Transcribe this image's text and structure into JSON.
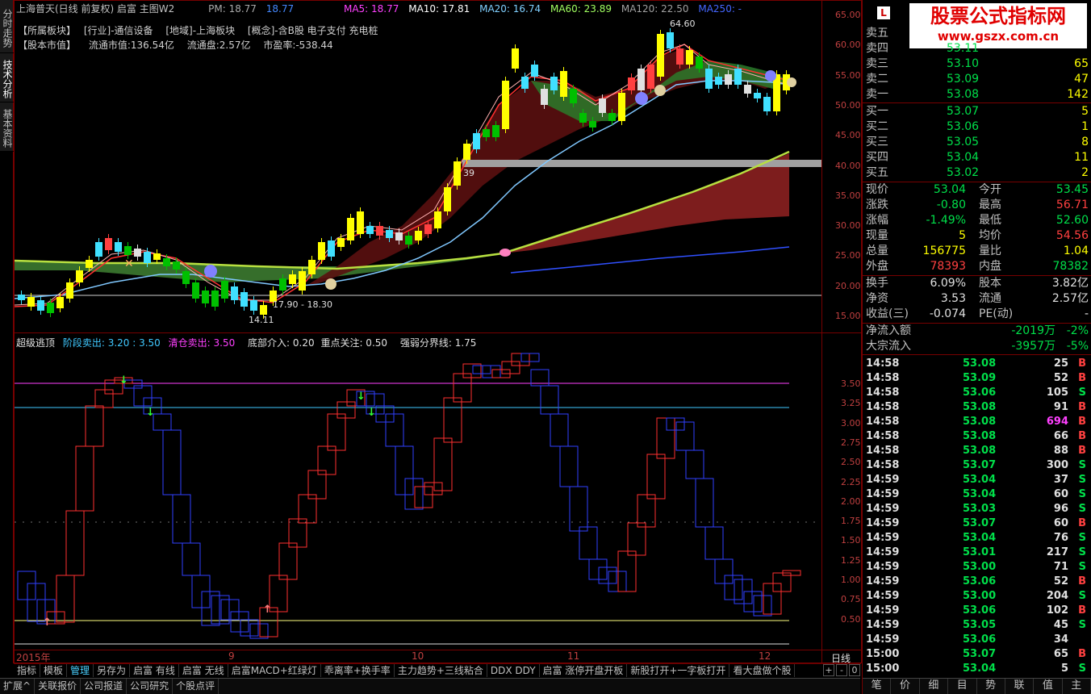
{
  "title": {
    "stock": "上海普天(日线 前复权) 启富 主图W2",
    "pm": "PM: 18.77",
    "pm2": "18.77",
    "ma5": "MA5: 18.77",
    "ma10": "MA10: 17.81",
    "ma20": "MA20: 16.74",
    "ma60": "MA60: 23.89",
    "ma120": "MA120: 22.50",
    "ma250": "MA250: -"
  },
  "info": {
    "line1": [
      "【所属板块】",
      "[行业]-通信设备",
      "[地域]-上海板块",
      "[概念]-含B股 电子支付 充电桩"
    ],
    "line2_label": "【股本市值】",
    "float_value": "流通市值:136.54亿",
    "float_shares": "流通盘:2.57亿",
    "pe": "市盈率:-538.44"
  },
  "sidetabs": [
    "分时走势",
    "技术分析",
    "基本资料"
  ],
  "price_axis": [
    "65.00",
    "60.00",
    "55.00",
    "50.00",
    "45.00",
    "40.00",
    "35.00",
    "30.00",
    "25.00",
    "20.00",
    "15.00"
  ],
  "chart_annotations": {
    "high": "64.60",
    "low": "14.11",
    "range": "17.90 - 18.30",
    "mid": "39"
  },
  "indicator": {
    "name": "超级逃顶",
    "stage_sell": "阶段卖出: 3.20 : 3.50",
    "clear_sell": "清仓卖出: 3.50",
    "bottom": "底部介入: 0.20",
    "focus": "重点关注: 0.50",
    "strong": "强弱分界线: 1.75"
  },
  "ind_axis": [
    "3.50",
    "3.25",
    "3.00",
    "2.75",
    "2.50",
    "2.25",
    "2.00",
    "1.75",
    "1.50",
    "1.25",
    "1.00",
    "0.75",
    "0.50"
  ],
  "date_axis": [
    "2015年",
    "9",
    "10",
    "11",
    "12"
  ],
  "period": "日线",
  "bottom_tabs": [
    "指标",
    "模板",
    "管理",
    "另存为",
    "启富 有线",
    "启富 无线",
    "启富MACD+红绿灯",
    "乖离率+换手率",
    "主力趋势+三线粘合",
    "DDX DDY",
    "启富 涨停开盘开板",
    "新股打开+一字板打开",
    "看大盘做个股"
  ],
  "status_tabs": [
    "扩展^",
    "关联报价",
    "公司报道",
    "公司研究",
    "个股点评"
  ],
  "nav_buttons": [
    "+",
    "-",
    "0"
  ],
  "logo": {
    "line1": "股票公式指标网",
    "line2": "www.gszx.com.cn"
  },
  "order_book": {
    "sells": [
      {
        "label": "卖五",
        "price": "",
        "vol": ""
      },
      {
        "label": "卖四",
        "price": "53.11",
        "vol": ""
      },
      {
        "label": "卖三",
        "price": "53.10",
        "vol": "65"
      },
      {
        "label": "卖二",
        "price": "53.09",
        "vol": "47"
      },
      {
        "label": "卖一",
        "price": "53.08",
        "vol": "142"
      }
    ],
    "buys": [
      {
        "label": "买一",
        "price": "53.07",
        "vol": "5"
      },
      {
        "label": "买二",
        "price": "53.06",
        "vol": "1"
      },
      {
        "label": "买三",
        "price": "53.05",
        "vol": "8"
      },
      {
        "label": "买四",
        "price": "53.04",
        "vol": "11"
      },
      {
        "label": "买五",
        "price": "53.02",
        "vol": "2"
      }
    ]
  },
  "quote": [
    {
      "l1": "现价",
      "v1": "53.04",
      "l2": "今开",
      "v2": "53.45"
    },
    {
      "l1": "涨跌",
      "v1": "-0.80",
      "l2": "最高",
      "v2": "56.71"
    },
    {
      "l1": "涨幅",
      "v1": "-1.49%",
      "l2": "最低",
      "v2": "52.60"
    },
    {
      "l1": "现量",
      "v1": "5",
      "l2": "均价",
      "v2": "54.56"
    },
    {
      "l1": "总量",
      "v1": "156775",
      "l2": "量比",
      "v2": "1.04"
    },
    {
      "l1": "外盘",
      "v1": "78393",
      "l2": "内盘",
      "v2": "78382"
    }
  ],
  "fundamentals": [
    {
      "l1": "换手",
      "v1": "6.09%",
      "l2": "股本",
      "v2": "3.82亿"
    },
    {
      "l1": "净资",
      "v1": "3.53",
      "l2": "流通",
      "v2": "2.57亿"
    },
    {
      "l1": "收益(三)",
      "v1": "-0.074",
      "l2": "PE(动)",
      "v2": "-"
    }
  ],
  "flows": [
    {
      "label": "净流入额",
      "value": "-2019万",
      "pct": "-2%"
    },
    {
      "label": "大宗流入",
      "value": "-3957万",
      "pct": "-5%"
    }
  ],
  "ticks": [
    {
      "time": "14:58",
      "price": "53.08",
      "vol": "25",
      "side": "B"
    },
    {
      "time": "14:58",
      "price": "53.09",
      "vol": "52",
      "side": "B"
    },
    {
      "time": "14:58",
      "price": "53.06",
      "vol": "105",
      "side": "S"
    },
    {
      "time": "14:58",
      "price": "53.08",
      "vol": "91",
      "side": "B"
    },
    {
      "time": "14:58",
      "price": "53.08",
      "vol": "694",
      "side": "B"
    },
    {
      "time": "14:58",
      "price": "53.08",
      "vol": "66",
      "side": "B"
    },
    {
      "time": "14:58",
      "price": "53.08",
      "vol": "88",
      "side": "B"
    },
    {
      "time": "14:58",
      "price": "53.07",
      "vol": "300",
      "side": "S"
    },
    {
      "time": "14:59",
      "price": "53.04",
      "vol": "37",
      "side": "S"
    },
    {
      "time": "14:59",
      "price": "53.04",
      "vol": "60",
      "side": "S"
    },
    {
      "time": "14:59",
      "price": "53.03",
      "vol": "96",
      "side": "S"
    },
    {
      "time": "14:59",
      "price": "53.07",
      "vol": "60",
      "side": "B"
    },
    {
      "time": "14:59",
      "price": "53.04",
      "vol": "76",
      "side": "S"
    },
    {
      "time": "14:59",
      "price": "53.01",
      "vol": "217",
      "side": "S"
    },
    {
      "time": "14:59",
      "price": "53.00",
      "vol": "71",
      "side": "S"
    },
    {
      "time": "14:59",
      "price": "53.06",
      "vol": "52",
      "side": "B"
    },
    {
      "time": "14:59",
      "price": "53.00",
      "vol": "204",
      "side": "S"
    },
    {
      "time": "14:59",
      "price": "53.06",
      "vol": "102",
      "side": "B"
    },
    {
      "time": "14:59",
      "price": "53.05",
      "vol": "45",
      "side": "S"
    },
    {
      "time": "14:59",
      "price": "53.06",
      "vol": "34",
      "side": ""
    },
    {
      "time": "15:00",
      "price": "53.07",
      "vol": "65",
      "side": "B"
    },
    {
      "time": "15:00",
      "price": "53.04",
      "vol": "5",
      "side": "S"
    }
  ],
  "right_tabs": [
    "笔",
    "价",
    "细",
    "目",
    "势",
    "联",
    "值",
    "主"
  ]
}
